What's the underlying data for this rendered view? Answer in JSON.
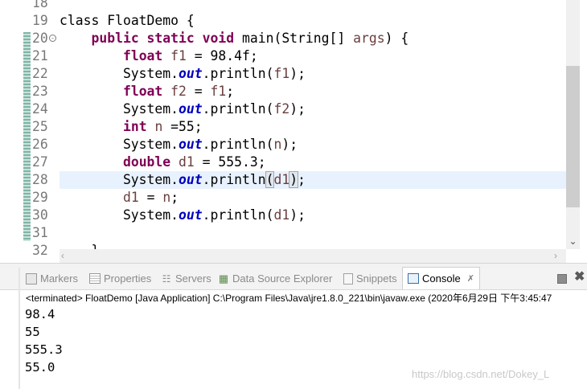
{
  "editor": {
    "lines": [
      {
        "num": "18",
        "tokens": []
      },
      {
        "num": "19",
        "tokens": [
          [
            "kw-plain",
            "class FloatDemo {"
          ]
        ]
      },
      {
        "num": "20",
        "fold": "⊖",
        "tokens": [
          [
            "plain",
            "    "
          ],
          [
            "kw",
            "public static void"
          ],
          [
            "plain",
            " main(String[] "
          ],
          [
            "var",
            "args"
          ],
          [
            "plain",
            ") {"
          ]
        ]
      },
      {
        "num": "21",
        "tokens": [
          [
            "plain",
            "        "
          ],
          [
            "kw",
            "float"
          ],
          [
            "plain",
            " "
          ],
          [
            "var",
            "f1"
          ],
          [
            "plain",
            " = 98.4f;"
          ]
        ]
      },
      {
        "num": "22",
        "tokens": [
          [
            "plain",
            "        System."
          ],
          [
            "field",
            "out"
          ],
          [
            "plain",
            ".println("
          ],
          [
            "var",
            "f1"
          ],
          [
            "plain",
            ");"
          ]
        ]
      },
      {
        "num": "23",
        "tokens": [
          [
            "plain",
            "        "
          ],
          [
            "kw",
            "float"
          ],
          [
            "plain",
            " "
          ],
          [
            "var",
            "f2"
          ],
          [
            "plain",
            " = "
          ],
          [
            "var",
            "f1"
          ],
          [
            "plain",
            ";"
          ]
        ]
      },
      {
        "num": "24",
        "tokens": [
          [
            "plain",
            "        System."
          ],
          [
            "field",
            "out"
          ],
          [
            "plain",
            ".println("
          ],
          [
            "var",
            "f2"
          ],
          [
            "plain",
            ");"
          ]
        ]
      },
      {
        "num": "25",
        "tokens": [
          [
            "plain",
            "        "
          ],
          [
            "kw",
            "int"
          ],
          [
            "plain",
            " "
          ],
          [
            "var",
            "n"
          ],
          [
            "plain",
            " =55;"
          ]
        ]
      },
      {
        "num": "26",
        "tokens": [
          [
            "plain",
            "        System."
          ],
          [
            "field",
            "out"
          ],
          [
            "plain",
            ".println("
          ],
          [
            "var",
            "n"
          ],
          [
            "plain",
            ");"
          ]
        ]
      },
      {
        "num": "27",
        "tokens": [
          [
            "plain",
            "        "
          ],
          [
            "kw",
            "double"
          ],
          [
            "plain",
            " "
          ],
          [
            "var",
            "d1"
          ],
          [
            "plain",
            " = 555.3;"
          ]
        ]
      },
      {
        "num": "28",
        "current": true,
        "tokens": [
          [
            "plain",
            "        System."
          ],
          [
            "field",
            "out"
          ],
          [
            "plain",
            ".println"
          ],
          [
            "caret",
            "("
          ],
          [
            "var",
            "d1"
          ],
          [
            "caret",
            ")"
          ],
          [
            "plain",
            ";"
          ]
        ]
      },
      {
        "num": "29",
        "tokens": [
          [
            "plain",
            "        "
          ],
          [
            "var",
            "d1"
          ],
          [
            "plain",
            " = "
          ],
          [
            "var",
            "n"
          ],
          [
            "plain",
            ";"
          ]
        ]
      },
      {
        "num": "30",
        "tokens": [
          [
            "plain",
            "        System."
          ],
          [
            "field",
            "out"
          ],
          [
            "plain",
            ".println("
          ],
          [
            "var",
            "d1"
          ],
          [
            "plain",
            ");"
          ]
        ]
      },
      {
        "num": "31",
        "tokens": []
      },
      {
        "num": "32",
        "tokens": [
          [
            "plain",
            "    }"
          ]
        ]
      }
    ]
  },
  "views": {
    "tabs": [
      {
        "label": "Markers",
        "icon": "markers-icon"
      },
      {
        "label": "Properties",
        "icon": "properties-icon"
      },
      {
        "label": "Servers",
        "icon": "servers-icon"
      },
      {
        "label": "Data Source Explorer",
        "icon": "data-source-explorer-icon"
      },
      {
        "label": "Snippets",
        "icon": "snippets-icon"
      },
      {
        "label": "Console",
        "icon": "console-icon",
        "active": true
      }
    ],
    "close_glyph": "✗",
    "close_view_glyph": "✖"
  },
  "console": {
    "status": "<terminated> FloatDemo [Java Application] C:\\Program Files\\Java\\jre1.8.0_221\\bin\\javaw.exe (2020年6月29日 下午3:45:47",
    "output": [
      "98.4",
      "55",
      "555.3",
      "55.0"
    ]
  },
  "watermark": "https://blog.csdn.net/Dokey_L",
  "colors": {
    "keyword": "#7f0055",
    "field": "#0000c0",
    "local_variable": "#6a3e3e",
    "current_line": "#e8f2fe",
    "line_number": "#787878"
  }
}
